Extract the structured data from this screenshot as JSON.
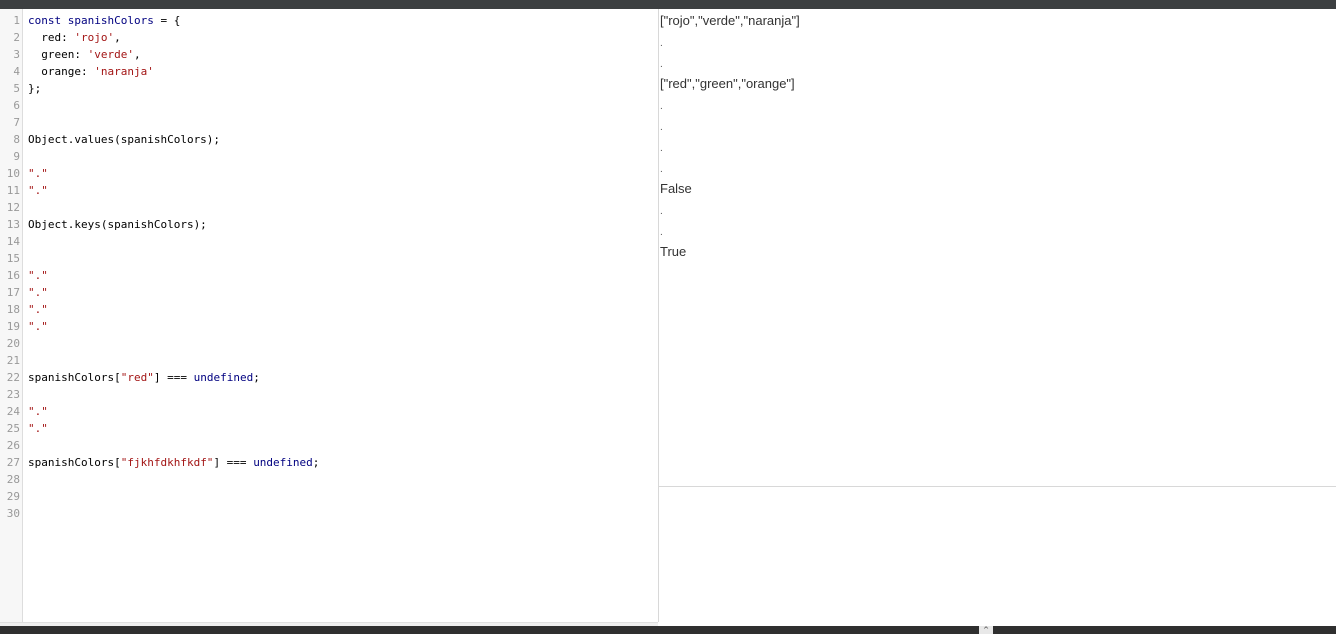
{
  "editor": {
    "line_numbers": [
      "1",
      "2",
      "3",
      "4",
      "5",
      "6",
      "7",
      "8",
      "9",
      "10",
      "11",
      "12",
      "13",
      "14",
      "15",
      "16",
      "17",
      "18",
      "19",
      "20",
      "21",
      "22",
      "23",
      "24",
      "25",
      "26",
      "27",
      "28",
      "29",
      "30"
    ],
    "lines": [
      {
        "n": 1,
        "parts": [
          {
            "t": "const ",
            "c": "kw"
          },
          {
            "t": "spanishColors",
            "c": "vr"
          },
          {
            "t": " = {",
            "c": ""
          }
        ]
      },
      {
        "n": 2,
        "parts": [
          {
            "t": "  red: ",
            "c": ""
          },
          {
            "t": "'rojo'",
            "c": "str"
          },
          {
            "t": ",",
            "c": ""
          }
        ]
      },
      {
        "n": 3,
        "parts": [
          {
            "t": "  green: ",
            "c": ""
          },
          {
            "t": "'verde'",
            "c": "str"
          },
          {
            "t": ",",
            "c": ""
          }
        ]
      },
      {
        "n": 4,
        "parts": [
          {
            "t": "  orange: ",
            "c": ""
          },
          {
            "t": "'naranja'",
            "c": "str"
          }
        ]
      },
      {
        "n": 5,
        "parts": [
          {
            "t": "};",
            "c": ""
          }
        ]
      },
      {
        "n": 8,
        "parts": [
          {
            "t": "Object.values(spanishColors);",
            "c": ""
          }
        ]
      },
      {
        "n": 10,
        "parts": [
          {
            "t": "\".\"",
            "c": "str"
          }
        ]
      },
      {
        "n": 11,
        "parts": [
          {
            "t": "\".\"",
            "c": "str"
          }
        ]
      },
      {
        "n": 13,
        "parts": [
          {
            "t": "Object.keys(spanishColors);",
            "c": ""
          }
        ]
      },
      {
        "n": 16,
        "parts": [
          {
            "t": "\".\"",
            "c": "str"
          }
        ]
      },
      {
        "n": 17,
        "parts": [
          {
            "t": "\".\"",
            "c": "str"
          }
        ]
      },
      {
        "n": 18,
        "parts": [
          {
            "t": "\".\"",
            "c": "str"
          }
        ]
      },
      {
        "n": 19,
        "parts": [
          {
            "t": "\".\"",
            "c": "str"
          }
        ]
      },
      {
        "n": 22,
        "parts": [
          {
            "t": "spanishColors[",
            "c": ""
          },
          {
            "t": "\"red\"",
            "c": "str"
          },
          {
            "t": "] === ",
            "c": ""
          },
          {
            "t": "undefined",
            "c": "kw"
          },
          {
            "t": ";",
            "c": ""
          }
        ]
      },
      {
        "n": 24,
        "parts": [
          {
            "t": "\".\"",
            "c": "str"
          }
        ]
      },
      {
        "n": 25,
        "parts": [
          {
            "t": "\".\"",
            "c": "str"
          }
        ]
      },
      {
        "n": 27,
        "parts": [
          {
            "t": "spanishColors[",
            "c": ""
          },
          {
            "t": "\"fjkhfdkhfkdf\"",
            "c": "str"
          },
          {
            "t": "] === ",
            "c": ""
          },
          {
            "t": "undefined",
            "c": "kw"
          },
          {
            "t": ";",
            "c": ""
          }
        ]
      }
    ]
  },
  "output": {
    "results": [
      {
        "kind": "text",
        "text": "[\"rojo\",\"verde\",\"naranja\"]"
      },
      {
        "kind": "dot",
        "text": "."
      },
      {
        "kind": "dot",
        "text": "."
      },
      {
        "kind": "text",
        "text": "[\"red\",\"green\",\"orange\"]"
      },
      {
        "kind": "dot",
        "text": "."
      },
      {
        "kind": "dot",
        "text": "."
      },
      {
        "kind": "dot",
        "text": "."
      },
      {
        "kind": "dot",
        "text": "."
      },
      {
        "kind": "text",
        "text": "False"
      },
      {
        "kind": "dot",
        "text": "."
      },
      {
        "kind": "dot",
        "text": "."
      },
      {
        "kind": "text",
        "text": "True"
      }
    ]
  },
  "icons": {
    "resize_handle": "caret-up-icon"
  },
  "colors": {
    "keyword": "#000080",
    "string": "#a31515",
    "topbar": "#3c3f41",
    "gutter": "#f7f7f7"
  }
}
